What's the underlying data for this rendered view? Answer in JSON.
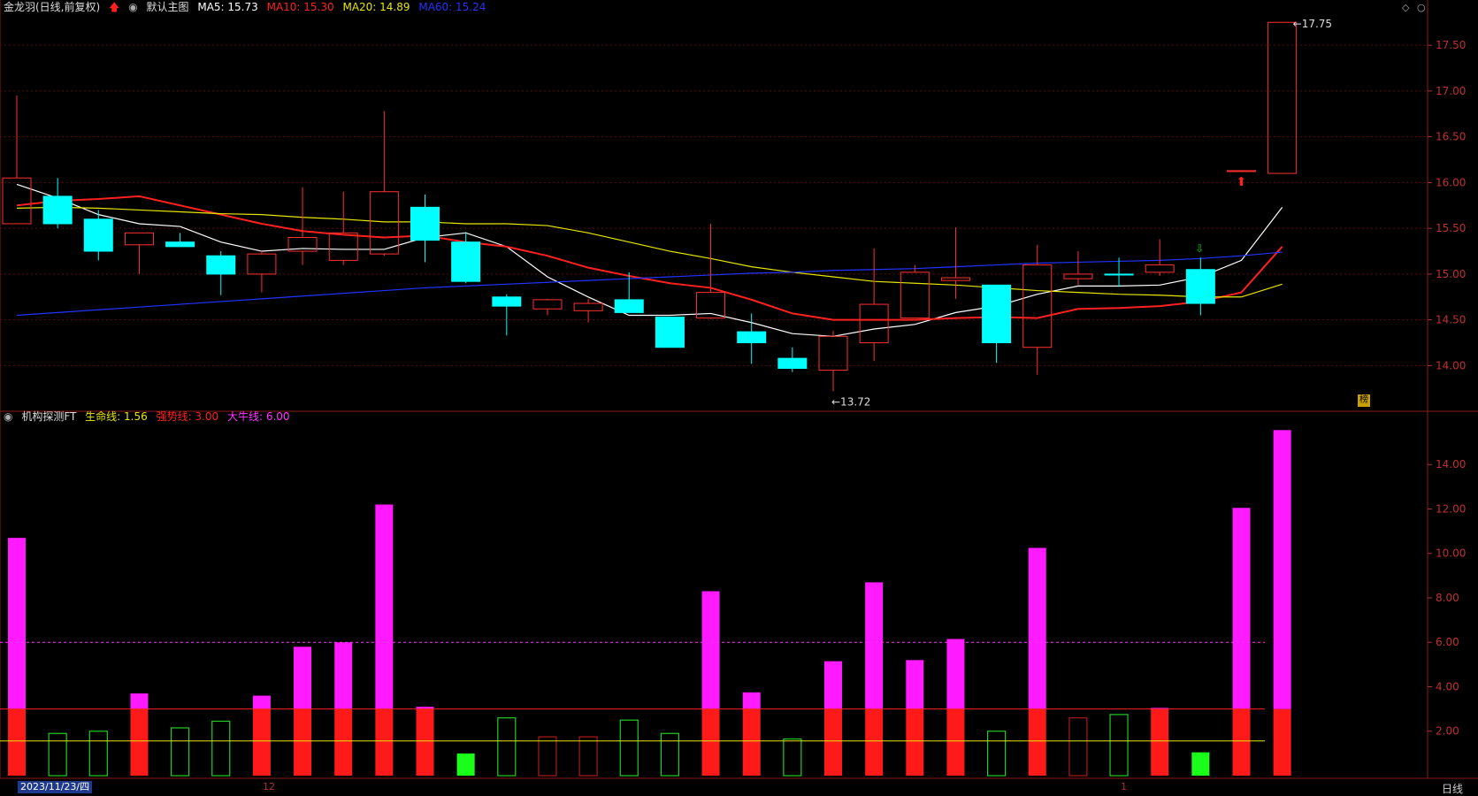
{
  "main_header": {
    "stock_name": "金龙羽(日线,前复权)",
    "template": "默认主图",
    "indicators": [
      {
        "label": "MA5: 15.73",
        "color": "#ffffff"
      },
      {
        "label": "MA10: 15.30",
        "color": "#ff2020"
      },
      {
        "label": "MA20: 14.89",
        "color": "#e6e600"
      },
      {
        "label": "MA60: 15.24",
        "color": "#2233ff"
      }
    ]
  },
  "sub_header": {
    "name": "机构探测FT",
    "indicators": [
      {
        "label": "生命线: 1.56",
        "color": "#e6e600"
      },
      {
        "label": "强势线: 3.00",
        "color": "#ff2020"
      },
      {
        "label": "大牛线: 6.00",
        "color": "#ff33ff"
      }
    ]
  },
  "footer": {
    "date_label": "2023/11/23/四",
    "month_ticks": [
      "12",
      "1"
    ],
    "period_label": "日线"
  },
  "pane_tab_label": "榜",
  "chart_data": [
    {
      "type": "candlestick",
      "title": "金龙羽(日线,前复权)",
      "y_ticks": [
        14.0,
        14.5,
        15.0,
        15.5,
        16.0,
        16.5,
        17.0,
        17.5
      ],
      "ylim": [
        13.55,
        17.82
      ],
      "annotations": {
        "high_label": "17.75",
        "low_label": "13.72"
      },
      "candles": [
        {
          "o": 15.55,
          "h": 16.95,
          "l": 15.55,
          "c": 16.05
        },
        {
          "o": 15.85,
          "h": 16.05,
          "l": 15.5,
          "c": 15.55
        },
        {
          "o": 15.6,
          "h": 15.7,
          "l": 15.15,
          "c": 15.25
        },
        {
          "o": 15.32,
          "h": 15.45,
          "l": 15.0,
          "c": 15.45
        },
        {
          "o": 15.35,
          "h": 15.45,
          "l": 15.3,
          "c": 15.3
        },
        {
          "o": 15.2,
          "h": 15.25,
          "l": 14.77,
          "c": 15.0
        },
        {
          "o": 15.0,
          "h": 15.25,
          "l": 14.8,
          "c": 15.22
        },
        {
          "o": 15.25,
          "h": 15.95,
          "l": 15.1,
          "c": 15.4
        },
        {
          "o": 15.15,
          "h": 15.9,
          "l": 15.1,
          "c": 15.45
        },
        {
          "o": 15.22,
          "h": 16.78,
          "l": 15.2,
          "c": 15.9
        },
        {
          "o": 15.73,
          "h": 15.87,
          "l": 15.13,
          "c": 15.37
        },
        {
          "o": 15.35,
          "h": 15.46,
          "l": 14.9,
          "c": 14.92
        },
        {
          "o": 14.75,
          "h": 14.78,
          "l": 14.33,
          "c": 14.65
        },
        {
          "o": 14.62,
          "h": 14.73,
          "l": 14.55,
          "c": 14.72
        },
        {
          "o": 14.6,
          "h": 14.73,
          "l": 14.47,
          "c": 14.68
        },
        {
          "o": 14.72,
          "h": 15.02,
          "l": 14.58,
          "c": 14.58
        },
        {
          "o": 14.53,
          "h": 14.53,
          "l": 14.2,
          "c": 14.2
        },
        {
          "o": 14.52,
          "h": 15.55,
          "l": 14.51,
          "c": 14.8
        },
        {
          "o": 14.37,
          "h": 14.57,
          "l": 14.02,
          "c": 14.25
        },
        {
          "o": 14.08,
          "h": 14.2,
          "l": 13.93,
          "c": 13.97
        },
        {
          "o": 13.95,
          "h": 14.38,
          "l": 13.72,
          "c": 14.32
        },
        {
          "o": 14.25,
          "h": 15.28,
          "l": 14.05,
          "c": 14.67
        },
        {
          "o": 14.52,
          "h": 15.1,
          "l": 14.52,
          "c": 15.02
        },
        {
          "o": 14.93,
          "h": 15.51,
          "l": 14.73,
          "c": 14.96
        },
        {
          "o": 14.88,
          "h": 14.88,
          "l": 14.03,
          "c": 14.25
        },
        {
          "o": 14.2,
          "h": 15.32,
          "l": 13.9,
          "c": 15.1
        },
        {
          "o": 14.95,
          "h": 15.25,
          "l": 14.88,
          "c": 15.0
        },
        {
          "o": 15.0,
          "h": 15.18,
          "l": 14.86,
          "c": 14.99
        },
        {
          "o": 15.02,
          "h": 15.38,
          "l": 14.98,
          "c": 15.1
        },
        {
          "o": 15.05,
          "h": 15.18,
          "l": 14.55,
          "c": 14.68
        },
        {
          "o": 16.12,
          "h": 16.12,
          "l": 16.12,
          "c": 16.13
        },
        {
          "o": 16.1,
          "h": 17.75,
          "l": 16.1,
          "c": 17.75
        }
      ],
      "series": [
        {
          "name": "MA5",
          "color": "#ffffff",
          "values": [
            15.98,
            15.83,
            15.65,
            15.55,
            15.52,
            15.35,
            15.25,
            15.28,
            15.27,
            15.27,
            15.4,
            15.45,
            15.3,
            14.97,
            14.75,
            14.55,
            14.55,
            14.57,
            14.47,
            14.35,
            14.32,
            14.4,
            14.45,
            14.58,
            14.65,
            14.78,
            14.87,
            14.87,
            14.88,
            14.97,
            15.15,
            15.73
          ]
        },
        {
          "name": "MA10",
          "color": "#ff2020",
          "values": [
            15.75,
            15.8,
            15.82,
            15.85,
            15.75,
            15.65,
            15.55,
            15.47,
            15.43,
            15.4,
            15.42,
            15.35,
            15.3,
            15.2,
            15.07,
            14.98,
            14.9,
            14.85,
            14.72,
            14.57,
            14.5,
            14.5,
            14.5,
            14.52,
            14.53,
            14.52,
            14.62,
            14.63,
            14.65,
            14.7,
            14.8,
            15.3
          ]
        },
        {
          "name": "MA20",
          "color": "#e6e600",
          "values": [
            15.72,
            15.73,
            15.72,
            15.7,
            15.68,
            15.66,
            15.65,
            15.62,
            15.6,
            15.57,
            15.57,
            15.55,
            15.55,
            15.53,
            15.45,
            15.35,
            15.25,
            15.17,
            15.08,
            15.02,
            14.97,
            14.92,
            14.9,
            14.88,
            14.85,
            14.82,
            14.8,
            14.78,
            14.77,
            14.75,
            14.75,
            14.89
          ]
        },
        {
          "name": "MA60",
          "color": "#2233ff",
          "values": [
            14.55,
            14.58,
            14.61,
            14.64,
            14.67,
            14.7,
            14.73,
            14.76,
            14.79,
            14.82,
            14.85,
            14.87,
            14.89,
            14.91,
            14.93,
            14.95,
            14.97,
            14.99,
            15.01,
            15.02,
            15.04,
            15.05,
            15.06,
            15.08,
            15.1,
            15.12,
            15.13,
            15.14,
            15.15,
            15.17,
            15.2,
            15.24
          ]
        }
      ]
    },
    {
      "type": "bar",
      "title": "机构探测FT",
      "y_ticks": [
        2.0,
        4.0,
        6.0,
        8.0,
        10.0,
        12.0,
        14.0
      ],
      "ylim": [
        0,
        15.8
      ],
      "reference_lines": [
        {
          "name": "生命线",
          "value": 1.56,
          "color": "#e6e600"
        },
        {
          "name": "强势线",
          "value": 3.0,
          "color": "#ff2020"
        },
        {
          "name": "大牛线",
          "value": 6.0,
          "color": "#ff33ff"
        }
      ],
      "values": [
        10.7,
        1.9,
        2.0,
        3.7,
        2.15,
        2.45,
        3.6,
        5.8,
        6.0,
        12.2,
        3.1,
        1.0,
        2.6,
        1.75,
        1.75,
        2.5,
        1.9,
        8.3,
        3.75,
        1.65,
        5.15,
        8.7,
        5.2,
        6.15,
        2.0,
        10.25,
        2.6,
        2.75,
        3.05,
        1.05,
        12.05,
        15.55
      ],
      "bar_kind": [
        "up",
        "down",
        "down",
        "up",
        "down",
        "down",
        "up",
        "up",
        "up",
        "up",
        "up",
        "solid-green",
        "down",
        "darkred",
        "darkred",
        "down",
        "down",
        "up",
        "up",
        "down",
        "up",
        "up",
        "up",
        "up",
        "down",
        "up",
        "darkred",
        "down",
        "up",
        "solid-green",
        "up",
        "up"
      ]
    }
  ]
}
